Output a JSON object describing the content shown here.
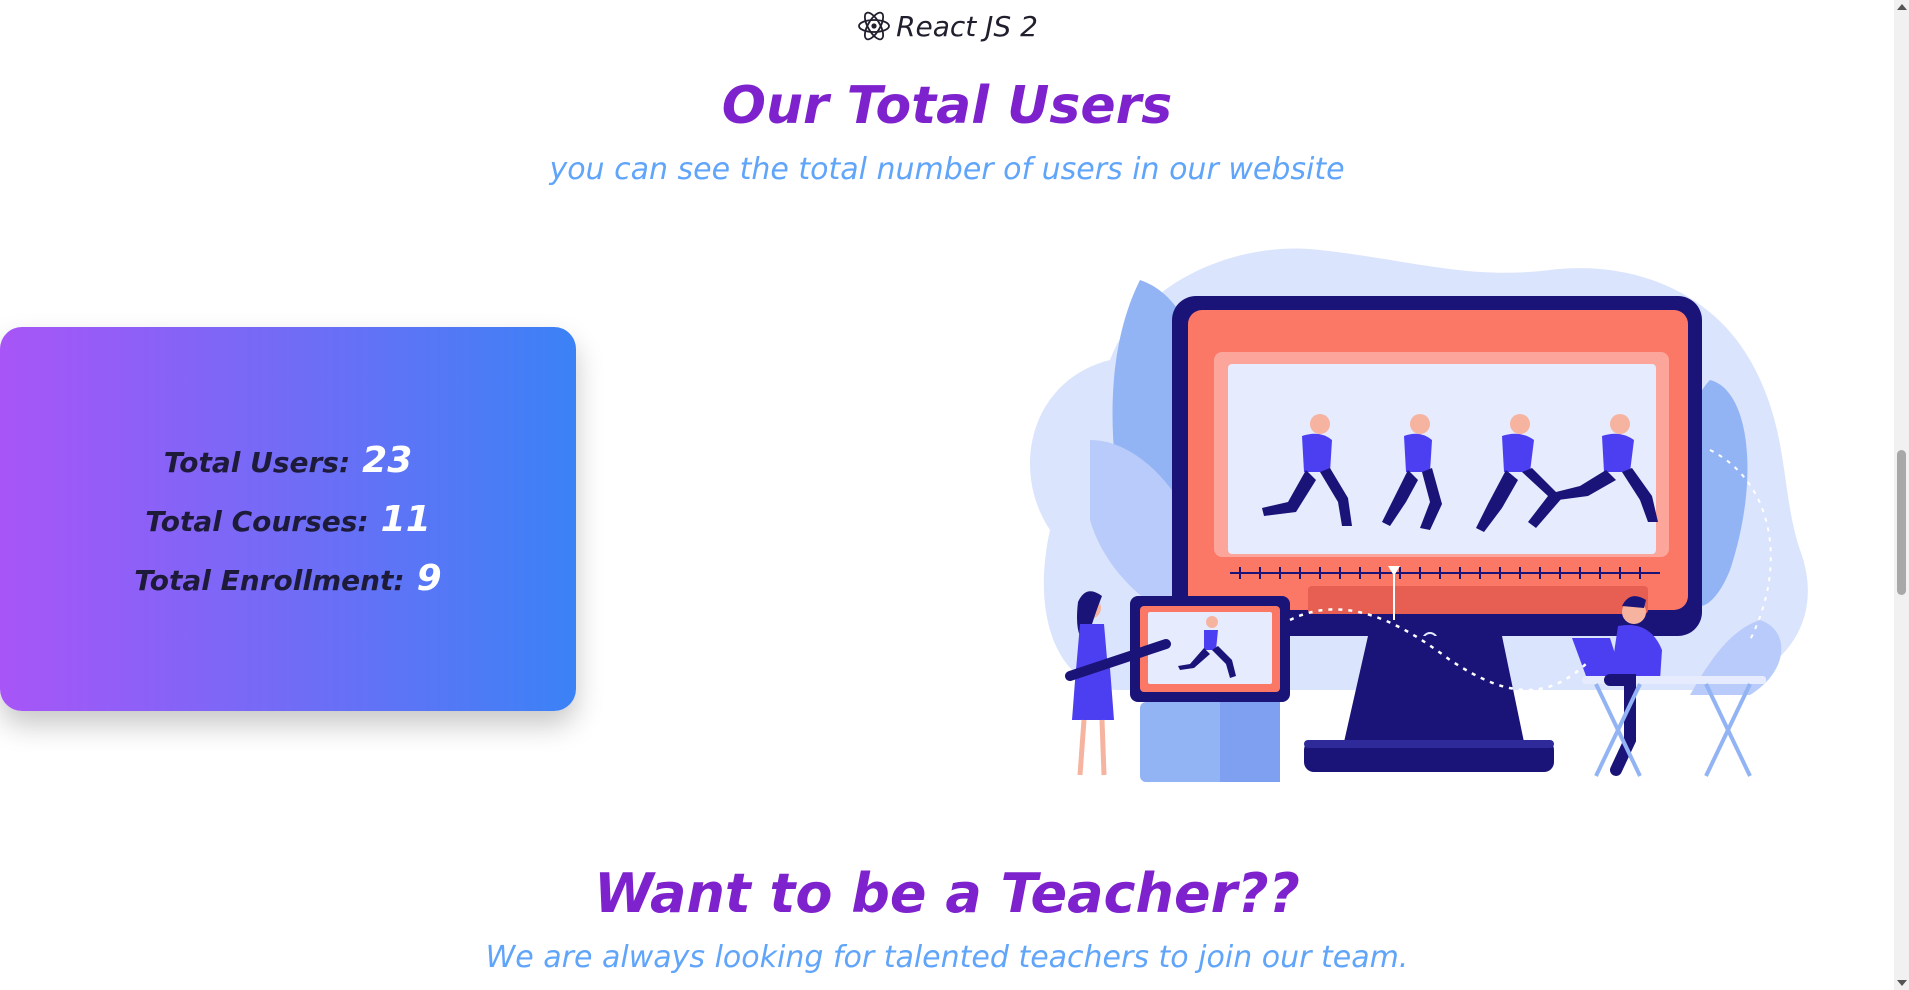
{
  "course_chip": {
    "label": "React JS 2",
    "icon": "react-atom-icon"
  },
  "users_section": {
    "title": "Our Total Users",
    "subtitle": "you can see the total number of users in our website"
  },
  "stats": [
    {
      "label": "Total Users:",
      "value": "23"
    },
    {
      "label": "Total Courses:",
      "value": "11"
    },
    {
      "label": "Total Enrollment:",
      "value": "9"
    }
  ],
  "teacher_section": {
    "title": "Want to be a Teacher??",
    "subtitle": "We are always looking for talented teachers to join our team."
  },
  "colors": {
    "title": "#7e22ce",
    "subtitle": "#60a5fa",
    "card_gradient_start": "#a855f7",
    "card_gradient_end": "#3b82f6"
  }
}
